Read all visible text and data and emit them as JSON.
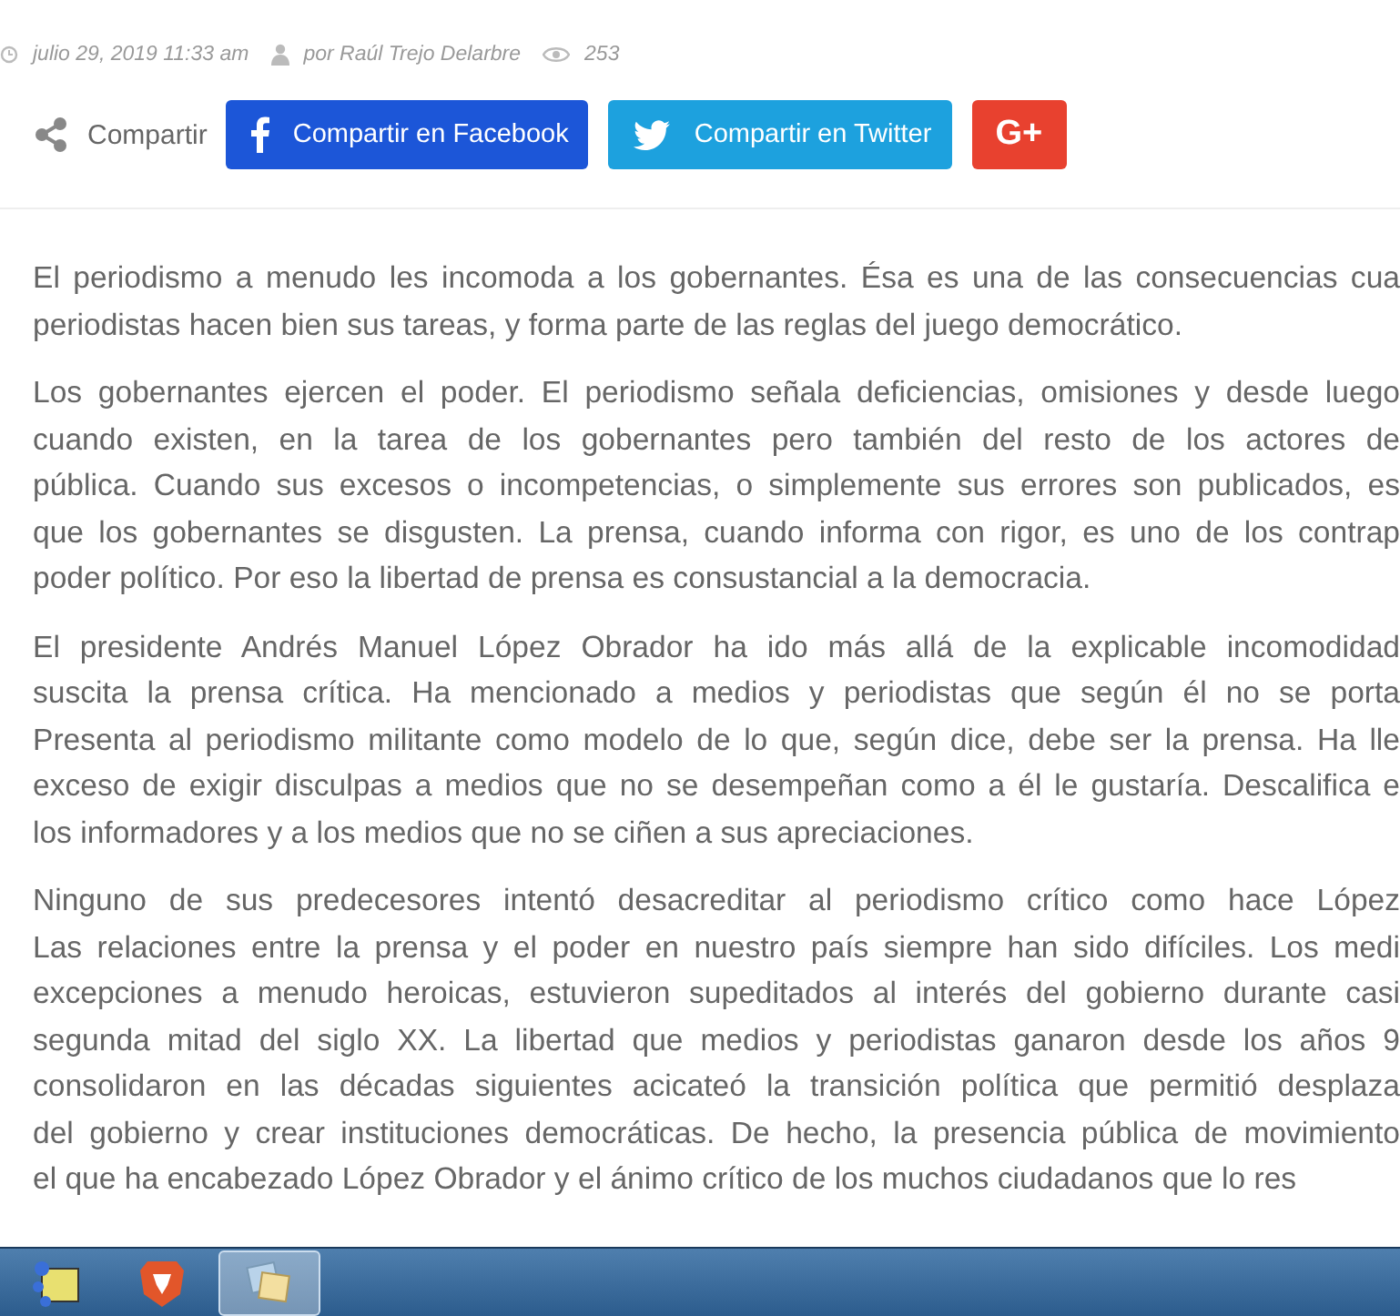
{
  "article": {
    "meta": {
      "date": "julio 29, 2019 11:33 am",
      "author": "por Raúl Trejo Delarbre",
      "views": "253"
    },
    "share": {
      "label": "Compartir",
      "buttons": [
        {
          "kind": "facebook",
          "label": "Compartir en Facebook"
        },
        {
          "kind": "twitter",
          "label": "Compartir en Twitter"
        },
        {
          "kind": "googleplus",
          "label": "G+"
        }
      ]
    },
    "paragraphs": [
      {
        "lines": [
          "El periodismo a menudo les incomoda a los gobernantes. Ésa es una de las consecuencias cua",
          "periodistas hacen bien sus tareas, y forma parte de las reglas del juego democrático."
        ]
      },
      {
        "lines": [
          "Los gobernantes ejercen el poder. El periodismo señala deficiencias, omisiones y desde luego",
          "cuando existen, en la tarea de los gobernantes pero también del resto de los actores de",
          "pública. Cuando sus excesos o incompetencias, o simplemente sus errores son publicados, es",
          "que los gobernantes se disgusten. La prensa, cuando informa con rigor, es uno de los contrap",
          "poder político. Por eso la libertad de prensa es consustancial a la democracia."
        ]
      },
      {
        "lines": [
          "El presidente Andrés Manuel López Obrador ha ido más allá de la explicable incomodidad",
          "suscita la prensa crítica. Ha mencionado a medios y periodistas que según él no se porta",
          "Presenta al periodismo militante como modelo de lo que, según dice, debe ser la prensa. Ha lle",
          "exceso de exigir disculpas a medios que no se desempeñan como a él le gustaría. Descalifica e",
          "los informadores y a los medios que no se ciñen a sus apreciaciones."
        ]
      },
      {
        "lines": [
          "Ninguno de sus predecesores intentó desacreditar al periodismo crítico como hace López",
          "Las relaciones entre la prensa y el poder en nuestro país siempre han sido difíciles. Los medi",
          "excepciones a menudo heroicas, estuvieron supeditados al interés del gobierno durante casi",
          "segunda mitad del siglo XX. La libertad que medios y periodistas ganaron desde los años 9",
          "consolidaron en las décadas siguientes acicateó la transición política que permitió desplaza",
          "del gobierno y crear instituciones democráticas. De hecho, la presencia pública de movimiento",
          "el que ha encabezado López Obrador y el ánimo crítico de los muchos ciudadanos que lo res"
        ]
      }
    ]
  },
  "taskbar": {
    "items": [
      {
        "kind": "app",
        "selected": false
      },
      {
        "kind": "browser",
        "selected": false
      },
      {
        "kind": "notes",
        "selected": true
      }
    ]
  }
}
